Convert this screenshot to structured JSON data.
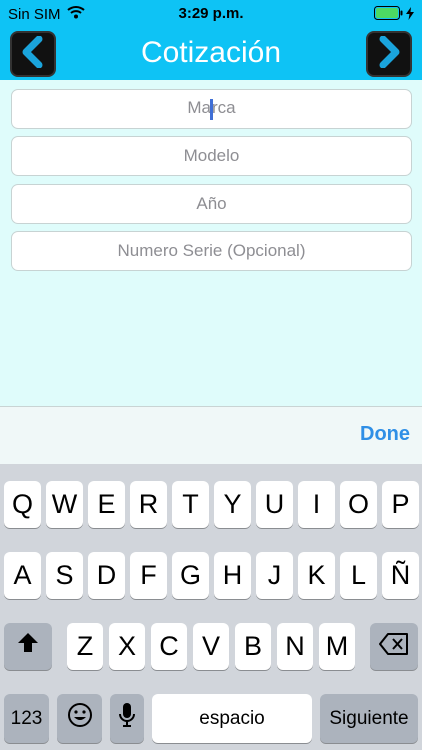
{
  "status": {
    "carrier": "Sin SIM",
    "time": "3:29 p.m."
  },
  "nav": {
    "title": "Cotización"
  },
  "form": {
    "fields": [
      {
        "placeholder": "Marca"
      },
      {
        "placeholder": "Modelo"
      },
      {
        "placeholder": "Año"
      },
      {
        "placeholder": "Numero Serie (Opcional)"
      }
    ]
  },
  "accessory": {
    "done_label": "Done"
  },
  "keyboard": {
    "row1": [
      "Q",
      "W",
      "E",
      "R",
      "T",
      "Y",
      "U",
      "I",
      "O",
      "P"
    ],
    "row2": [
      "A",
      "S",
      "D",
      "F",
      "G",
      "H",
      "J",
      "K",
      "L",
      "Ñ"
    ],
    "row3": [
      "Z",
      "X",
      "C",
      "V",
      "B",
      "N",
      "M"
    ],
    "numbers_label": "123",
    "space_label": "espacio",
    "return_label": "Siguiente"
  },
  "colors": {
    "header": "#0ec3f5",
    "background": "#dffcfb",
    "accent": "#2f8fe6"
  }
}
